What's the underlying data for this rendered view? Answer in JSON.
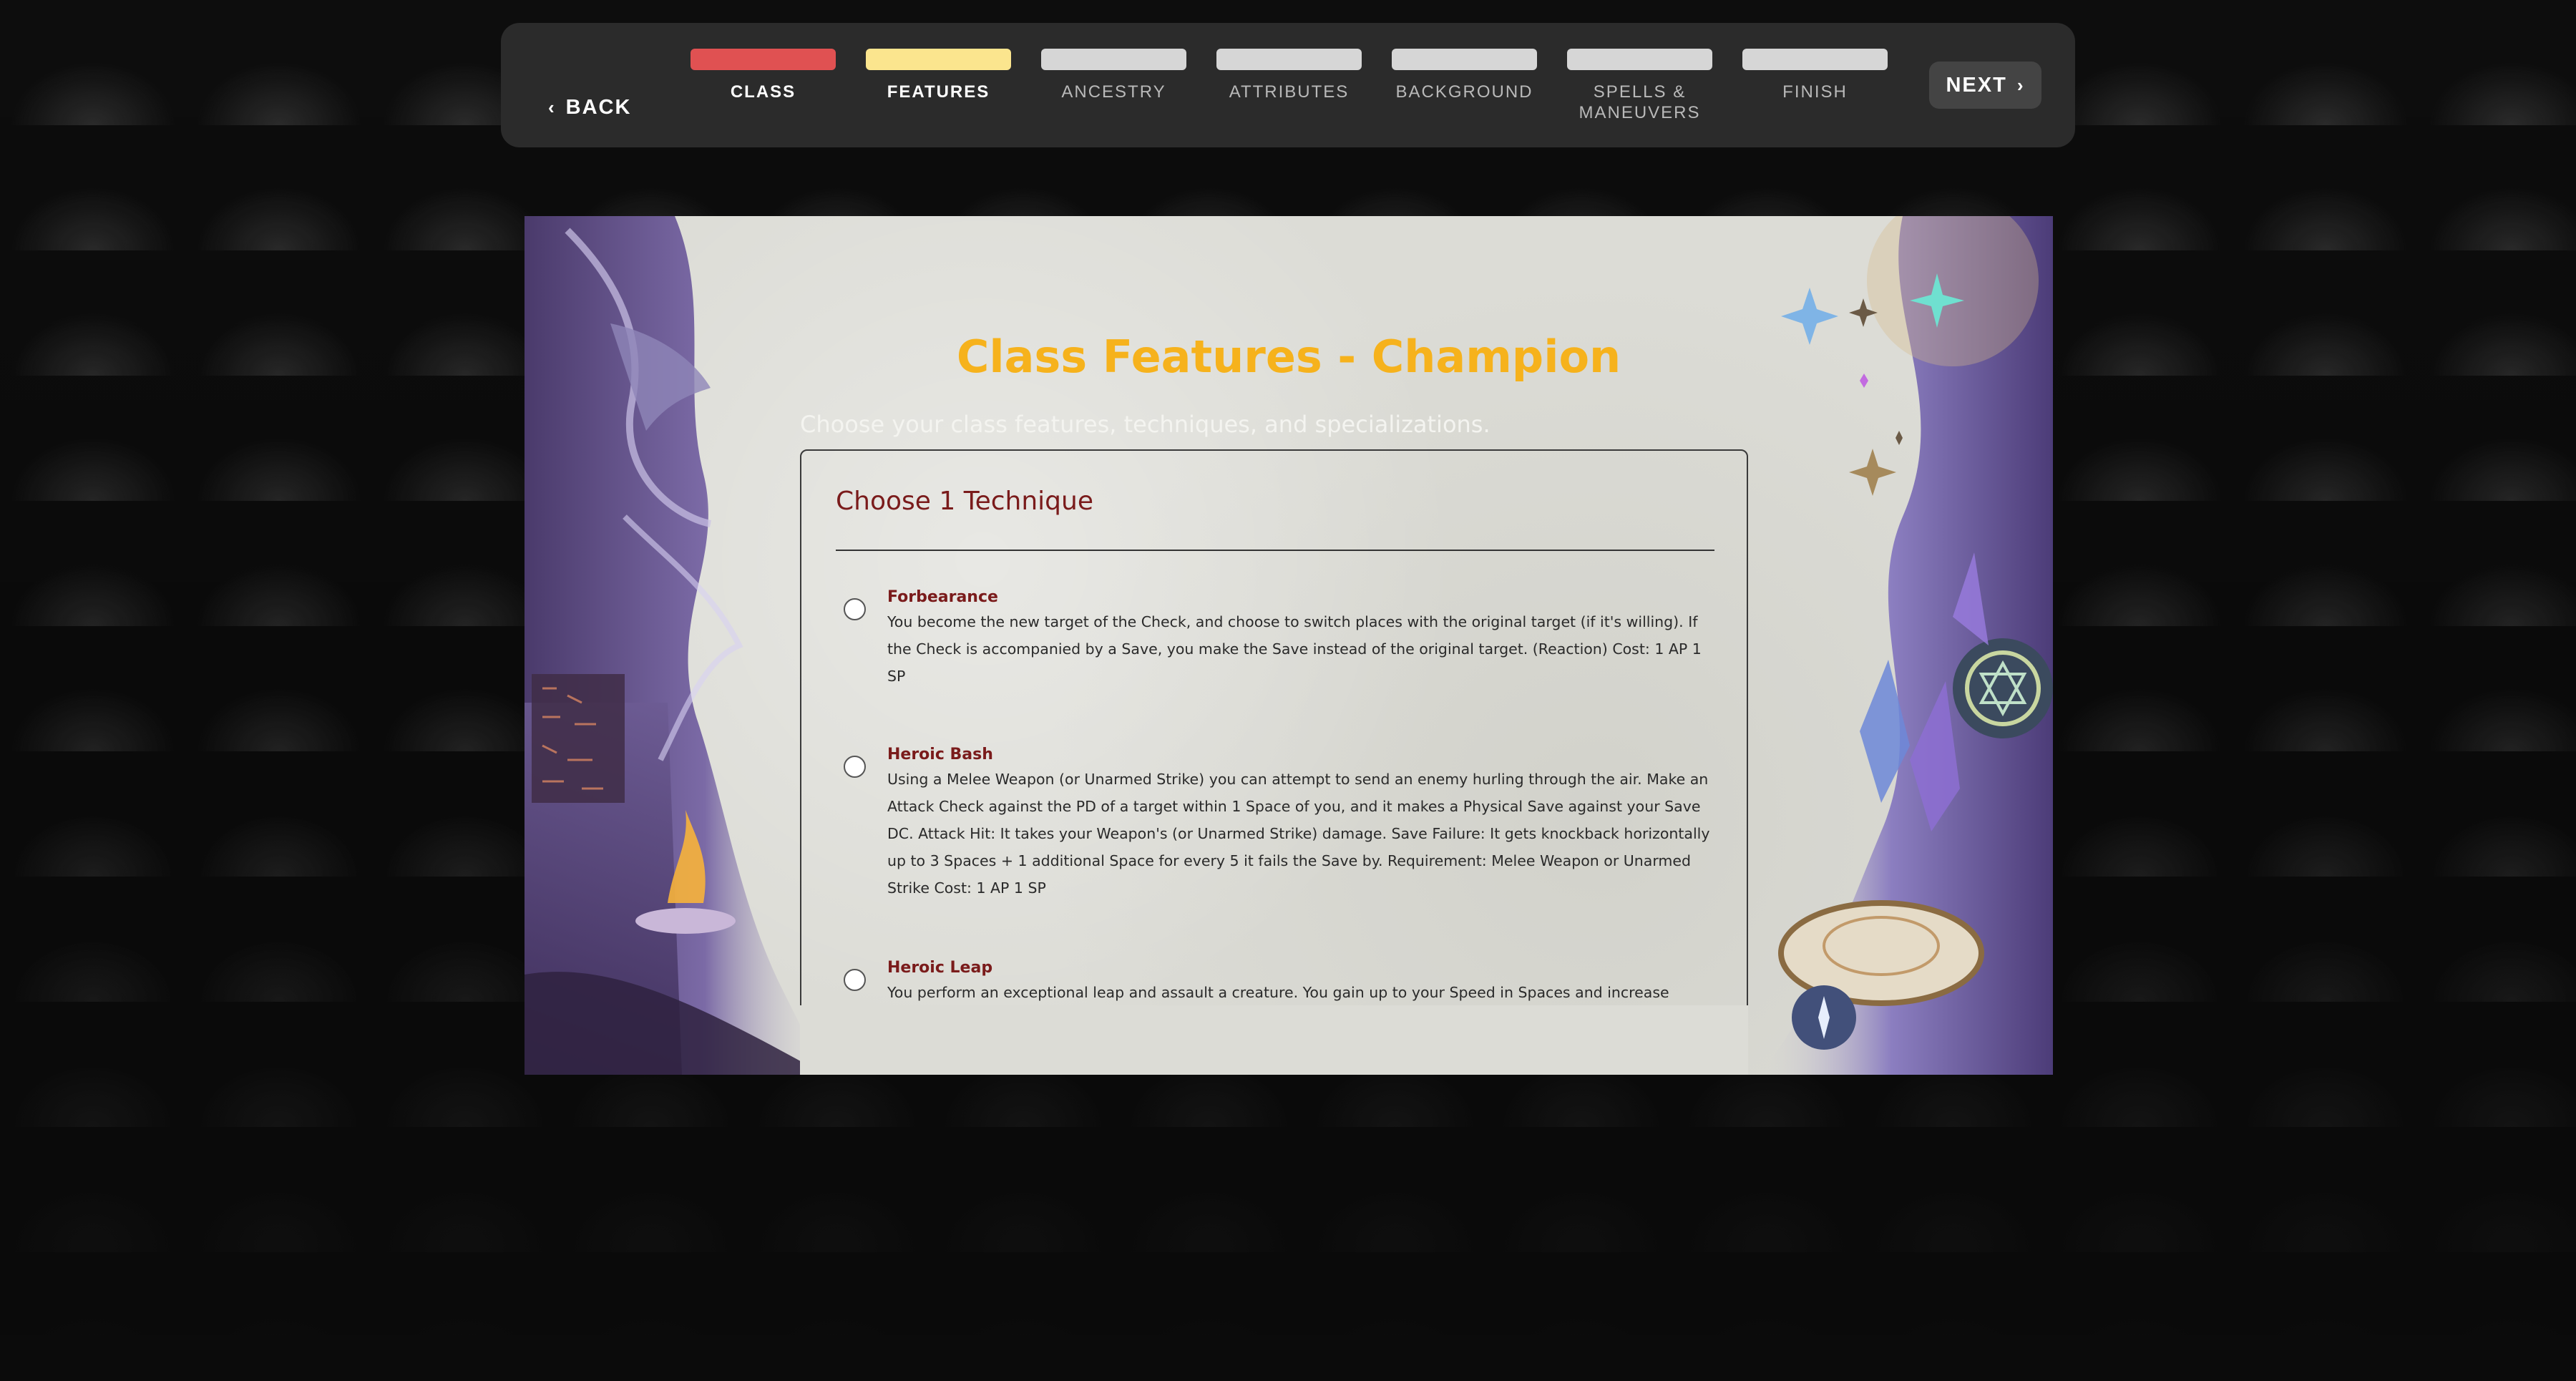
{
  "nav": {
    "back_label": "BACK",
    "next_label": "NEXT",
    "back_icon": "chevron-left-icon",
    "next_icon": "chevron-right-icon",
    "steps": [
      {
        "label": "CLASS",
        "bar_color": "#e05152",
        "state": "done"
      },
      {
        "label": "FEATURES",
        "bar_color": "#fbe58e",
        "state": "active"
      },
      {
        "label": "ANCESTRY",
        "bar_color": "#d6d6d6",
        "state": "pending"
      },
      {
        "label": "ATTRIBUTES",
        "bar_color": "#d6d6d6",
        "state": "pending"
      },
      {
        "label": "BACKGROUND",
        "bar_color": "#d6d6d6",
        "state": "pending"
      },
      {
        "label": "SPELLS &\nMANEUVERS",
        "bar_color": "#d6d6d6",
        "state": "pending"
      },
      {
        "label": "FINISH",
        "bar_color": "#d6d6d6",
        "state": "pending"
      }
    ]
  },
  "card": {
    "title": "Class Features - Champion",
    "subtitle": "Choose your class features, techniques, and specializations.",
    "title_color": "#f6b21c",
    "panel_title": "Choose 1 Technique",
    "options": [
      {
        "name": "Forbearance",
        "description": "You become the new target of the Check, and choose to switch places with the original target (if it's willing). If the Check is accompanied by a Save, you make the Save instead of the original target. (Reaction) Cost: 1 AP 1 SP",
        "selected": false
      },
      {
        "name": "Heroic Bash",
        "description": "Using a Melee Weapon (or Unarmed Strike) you can attempt to send an enemy hurling through the air. Make an Attack Check against the PD of a target within 1 Space of you, and it makes a Physical Save against your Save DC. Attack Hit: It takes your Weapon's (or Unarmed Strike) damage. Save Failure: It gets knockback horizontally up to 3 Spaces + 1 additional Space for every 5 it fails the Save by. Requirement: Melee Weapon or Unarmed Strike Cost: 1 AP 1 SP",
        "selected": false
      },
      {
        "name": "Heroic Leap",
        "description": "You perform an exceptional leap and assault a creature. You gain up to your Speed in Spaces and increase",
        "selected": false
      }
    ]
  }
}
